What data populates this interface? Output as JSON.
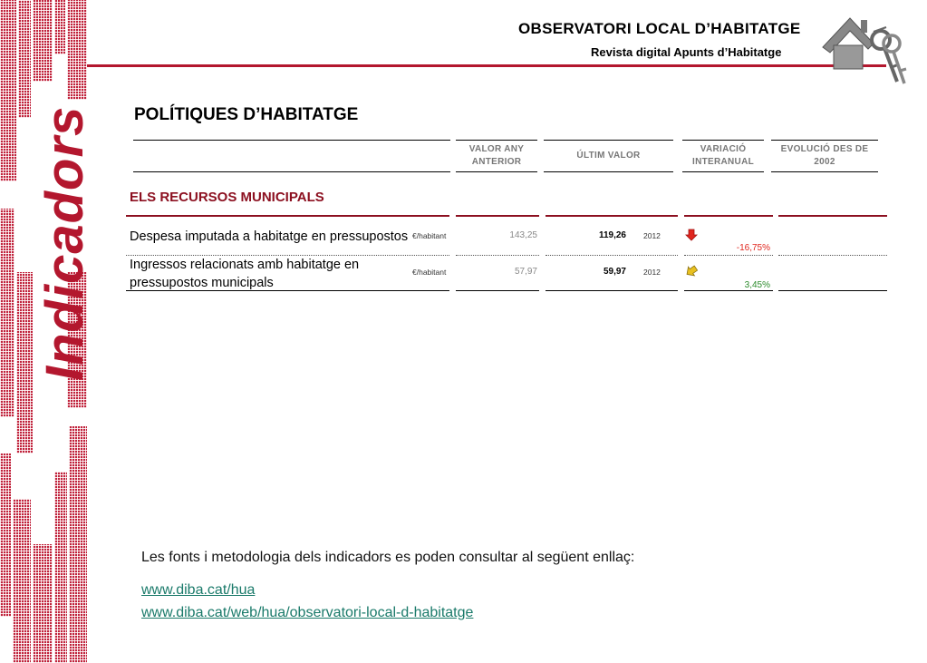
{
  "header": {
    "title": "OBSERVATORI LOCAL D’HABITATGE",
    "subtitle": "Revista digital Apunts d’Habitatge"
  },
  "side_word": "Indicadors",
  "section": {
    "title": "POLÍTIQUES D’HABITATGE"
  },
  "columns": {
    "prev_line1": "VALOR ANY",
    "prev_line2": "ANTERIOR",
    "last": "ÚLTIM VALOR",
    "var_line1": "VARIACIÓ",
    "var_line2": "INTERANUAL",
    "evo_line1": "EVOLUCIÓ DES DE",
    "evo_line2": "2002"
  },
  "group": {
    "title": "ELS RECURSOS MUNICIPALS"
  },
  "rows": [
    {
      "label_line1": "Despesa imputada a habitatge en pressupostos municipals",
      "label_line2": "",
      "unit": "€/habitant",
      "prev": "143,25",
      "last": "119,26",
      "year": "2012",
      "variation": "-16,75%",
      "trend": "down",
      "color": "#e0261e"
    },
    {
      "label_line1": "Ingressos relacionats amb habitatge en",
      "label_line2": "pressupostos municipals",
      "unit": "€/habitant",
      "prev": "57,97",
      "last": "59,97",
      "year": "2012",
      "variation": "3,45%",
      "trend": "up",
      "color": "#2a8a2a"
    }
  ],
  "footer": {
    "note": "Les fonts i metodologia dels indicadors es poden consultar al següent enllaç:",
    "link1": "www.diba.cat/hua",
    "link2": "www.diba.cat/web/hua/observatori-local-d-habitatge"
  },
  "colors": {
    "brand": "#b3172e",
    "link": "#1a7a6a"
  },
  "icons": [
    "house-keys-logo-icon",
    "arrow-down-icon",
    "arrow-up-icon"
  ]
}
